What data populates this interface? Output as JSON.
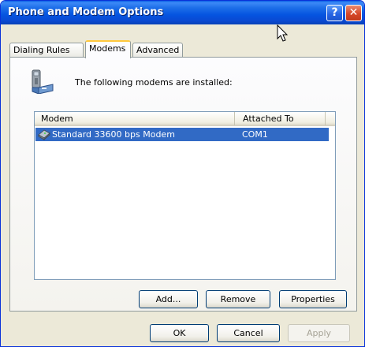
{
  "window": {
    "title": "Phone and Modem Options",
    "help_glyph": "?",
    "close_glyph": "✕"
  },
  "tabs": [
    {
      "label": "Dialing Rules",
      "active": false
    },
    {
      "label": "Modems",
      "active": true
    },
    {
      "label": "Advanced",
      "active": false
    }
  ],
  "modems_page": {
    "intro": "The following modems are  installed:",
    "list": {
      "columns": [
        "Modem",
        "Attached To"
      ],
      "rows": [
        {
          "modem": "Standard 33600 bps Modem",
          "attached_to": "COM1",
          "selected": true,
          "icon": "modem-icon"
        }
      ]
    },
    "buttons": {
      "add": "Add...",
      "remove": "Remove",
      "properties": "Properties"
    }
  },
  "dialog_buttons": {
    "ok": "OK",
    "cancel": "Cancel",
    "apply": "Apply"
  },
  "colors": {
    "titlebar": "#0554e0",
    "selection": "#316ac5",
    "face": "#ece9d8"
  }
}
